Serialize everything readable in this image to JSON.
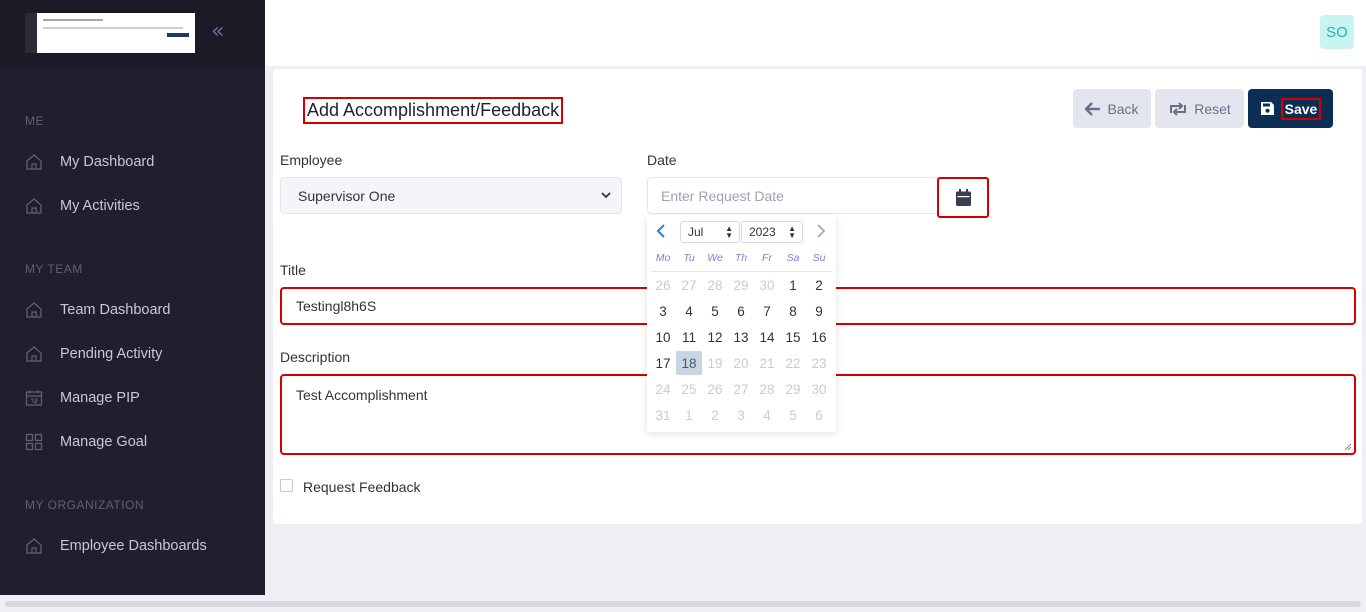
{
  "sidebar": {
    "collapse_glyph": "«",
    "sections": [
      {
        "title": "ME",
        "items": [
          {
            "label": "My Dashboard",
            "icon": "home-icon"
          },
          {
            "label": "My Activities",
            "icon": "home-icon"
          }
        ]
      },
      {
        "title": "MY TEAM",
        "items": [
          {
            "label": "Team Dashboard",
            "icon": "home-icon"
          },
          {
            "label": "Pending Activity",
            "icon": "home-icon"
          },
          {
            "label": "Manage PIP",
            "icon": "calendar-icon"
          },
          {
            "label": "Manage Goal",
            "icon": "grid-icon"
          }
        ]
      },
      {
        "title": "MY ORGANIZATION",
        "items": [
          {
            "label": "Employee Dashboards",
            "icon": "home-icon"
          }
        ]
      }
    ]
  },
  "topbar": {
    "avatar_initials": "SO"
  },
  "page": {
    "title": "Add Accomplishment/Feedback",
    "buttons": {
      "back": "Back",
      "reset": "Reset",
      "save": "Save"
    }
  },
  "form": {
    "employee_label": "Employee",
    "employee_value": "Supervisor One",
    "date_label": "Date",
    "date_placeholder": "Enter Request Date",
    "title_label": "Title",
    "title_value": "Testingl8h6S",
    "description_label": "Description",
    "description_value": "Test Accomplishment",
    "request_feedback_label": "Request Feedback",
    "request_feedback_checked": false
  },
  "datepicker": {
    "month": "Jul",
    "year": "2023",
    "weekdays": [
      "Mo",
      "Tu",
      "We",
      "Th",
      "Fr",
      "Sa",
      "Su"
    ],
    "days": [
      {
        "d": "26",
        "m": true
      },
      {
        "d": "27",
        "m": true
      },
      {
        "d": "28",
        "m": true
      },
      {
        "d": "29",
        "m": true
      },
      {
        "d": "30",
        "m": true
      },
      {
        "d": "1"
      },
      {
        "d": "2"
      },
      {
        "d": "3"
      },
      {
        "d": "4"
      },
      {
        "d": "5"
      },
      {
        "d": "6"
      },
      {
        "d": "7"
      },
      {
        "d": "8"
      },
      {
        "d": "9"
      },
      {
        "d": "10"
      },
      {
        "d": "11"
      },
      {
        "d": "12"
      },
      {
        "d": "13"
      },
      {
        "d": "14"
      },
      {
        "d": "15"
      },
      {
        "d": "16"
      },
      {
        "d": "17"
      },
      {
        "d": "18",
        "sel": true
      },
      {
        "d": "19",
        "m": true
      },
      {
        "d": "20",
        "m": true
      },
      {
        "d": "21",
        "m": true
      },
      {
        "d": "22",
        "m": true
      },
      {
        "d": "23",
        "m": true
      },
      {
        "d": "24",
        "m": true
      },
      {
        "d": "25",
        "m": true
      },
      {
        "d": "26",
        "m": true
      },
      {
        "d": "27",
        "m": true
      },
      {
        "d": "28",
        "m": true
      },
      {
        "d": "29",
        "m": true
      },
      {
        "d": "30",
        "m": true
      },
      {
        "d": "31",
        "m": true
      },
      {
        "d": "1",
        "m": true
      },
      {
        "d": "2",
        "m": true
      },
      {
        "d": "3",
        "m": true
      },
      {
        "d": "4",
        "m": true
      },
      {
        "d": "5",
        "m": true
      },
      {
        "d": "6",
        "m": true
      }
    ]
  },
  "colors": {
    "sidebar_bg": "#1f1f2e",
    "primary": "#0c2d54",
    "highlight_border": "#d40000",
    "avatar_bg": "#c9f4f0",
    "avatar_text": "#25b4ac"
  }
}
